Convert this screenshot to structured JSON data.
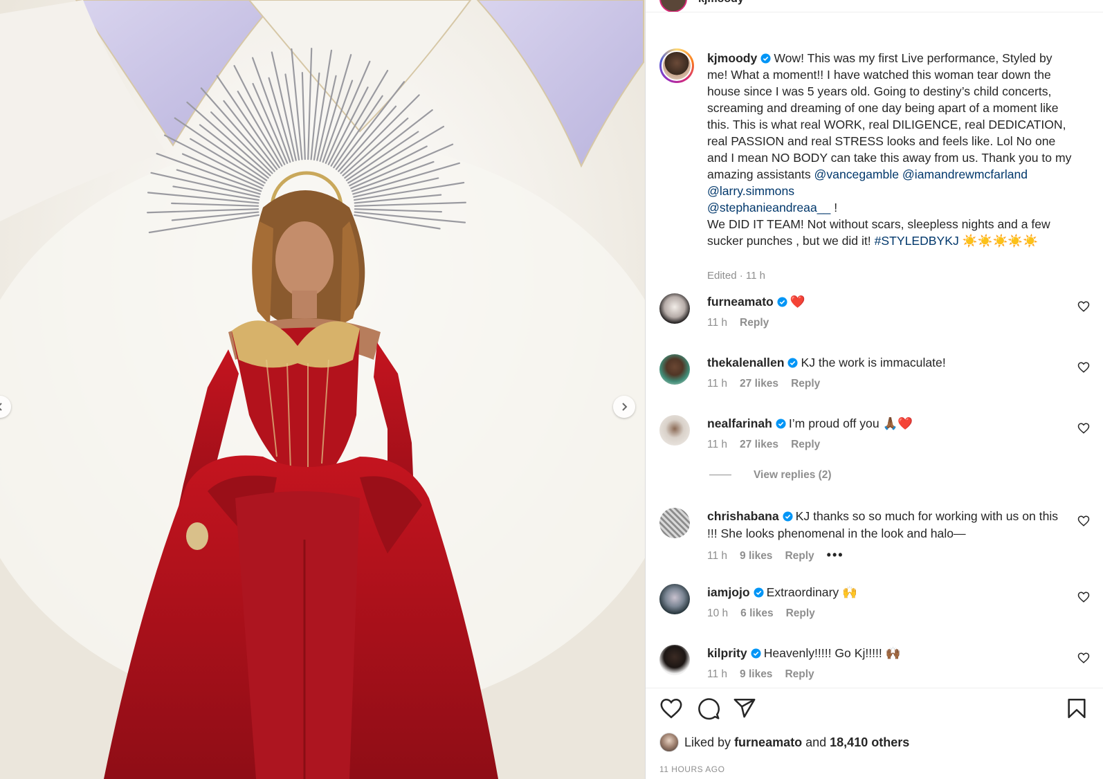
{
  "header": {
    "username": "kjmoody"
  },
  "caption": {
    "username": "kjmoody",
    "text_part1": "Wow! This was my first Live performance, Styled by me! What a moment!! I have watched this woman tear down the house since I was 5 years old. Going to destiny’s child concerts, screaming and dreaming of one day being apart of a moment like this. This is what real WORK, real DILIGENCE, real DEDICATION, real PASSION and real STRESS looks and feels like. Lol No one and I mean NO BODY can take this away from us. Thank you to my amazing assistants ",
    "mentions": [
      "@vancegamble",
      "@iamandrewmcfarland",
      "@larry.simmons",
      "@stephanieandreaa__"
    ],
    "text_part2": " !\nWe DID IT TEAM! Not without scars, sleepless nights and a few sucker punches , but we did it! ",
    "hashtag": "#STYLEDBYKJ",
    "emoji_tail": " ☀️☀️☀️☀️☀️",
    "edited": "Edited · 11 h"
  },
  "comments": [
    {
      "username": "furneamato",
      "text": "❤️",
      "time": "11 h",
      "likes": "",
      "reply": "Reply"
    },
    {
      "username": "thekalenallen",
      "text": "KJ the work is immaculate!",
      "time": "11 h",
      "likes": "27 likes",
      "reply": "Reply"
    },
    {
      "username": "nealfarinah",
      "text": "I’m proud off you 🙏🏾❤️",
      "time": "11 h",
      "likes": "27 likes",
      "reply": "Reply"
    },
    {
      "username": "chrishabana",
      "text": "KJ thanks so so much for working with us on this !!! She looks phenomenal in the look and halo—",
      "time": "11 h",
      "likes": "9 likes",
      "reply": "Reply"
    },
    {
      "username": "iamjojo",
      "text": "Extraordinary 🙌",
      "time": "10 h",
      "likes": "6 likes",
      "reply": "Reply"
    },
    {
      "username": "kilprity",
      "text": "Heavenly!!!!! Go Kj!!!!! 🙌🏾",
      "time": "11 h",
      "likes": "9 likes",
      "reply": "Reply"
    }
  ],
  "view_replies": "View replies (2)",
  "likes": {
    "prefix": "Liked by",
    "user": "furneamato",
    "and": "and",
    "others": "18,410 others"
  },
  "timestamp": "11 HOURS AGO",
  "colors": {
    "link": "#00376b",
    "verified": "#0095f6",
    "muted": "#8e8e8e",
    "gown": "#b3121c"
  },
  "icons": [
    "chevron-left-icon",
    "chevron-right-icon",
    "verified-badge-icon",
    "heart-icon",
    "comment-icon",
    "share-icon",
    "bookmark-icon",
    "more-icon"
  ]
}
